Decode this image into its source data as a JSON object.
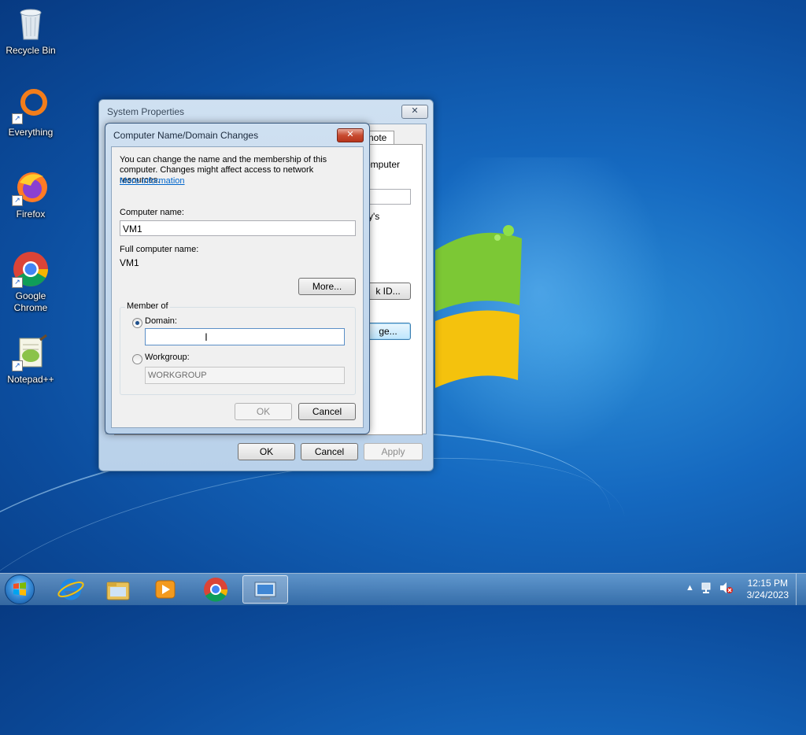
{
  "desktop": {
    "icons": [
      {
        "label": "Recycle Bin",
        "icon": "recycle-bin-icon"
      },
      {
        "label": "Everything",
        "icon": "everything-icon"
      },
      {
        "label": "Firefox",
        "icon": "firefox-icon"
      },
      {
        "label": "Google Chrome",
        "icon": "chrome-icon"
      },
      {
        "label": "Notepad++",
        "icon": "notepadpp-icon"
      }
    ]
  },
  "system_properties": {
    "title": "System Properties",
    "close_glyph": "✕",
    "tab_fragment": "note",
    "text_fragments": [
      "omputer",
      "ry's"
    ],
    "network_id_fragment": "k ID...",
    "change_fragment": "ge...",
    "ok": "OK",
    "cancel": "Cancel",
    "apply": "Apply"
  },
  "name_dialog": {
    "title": "Computer Name/Domain Changes",
    "close_glyph": "✕",
    "intro": "You can change the name and the membership of this computer. Changes might affect access to network resources.",
    "more_info_link": "More information",
    "computer_name_label": "Computer name:",
    "computer_name_value": "VM1",
    "full_name_label": "Full computer name:",
    "full_name_value": "VM1",
    "more_button": "More...",
    "member_of_label": "Member of",
    "domain_label": "Domain:",
    "domain_value": "",
    "workgroup_label": "Workgroup:",
    "workgroup_value": "WORKGROUP",
    "selected_membership": "domain",
    "ok": "OK",
    "cancel": "Cancel"
  },
  "taskbar": {
    "items": [
      "internet-explorer-icon",
      "file-explorer-icon",
      "media-player-icon",
      "chrome-icon",
      "system-properties-icon"
    ],
    "time": "12:15 PM",
    "date": "3/24/2023",
    "tray_expand_glyph": "▲"
  }
}
